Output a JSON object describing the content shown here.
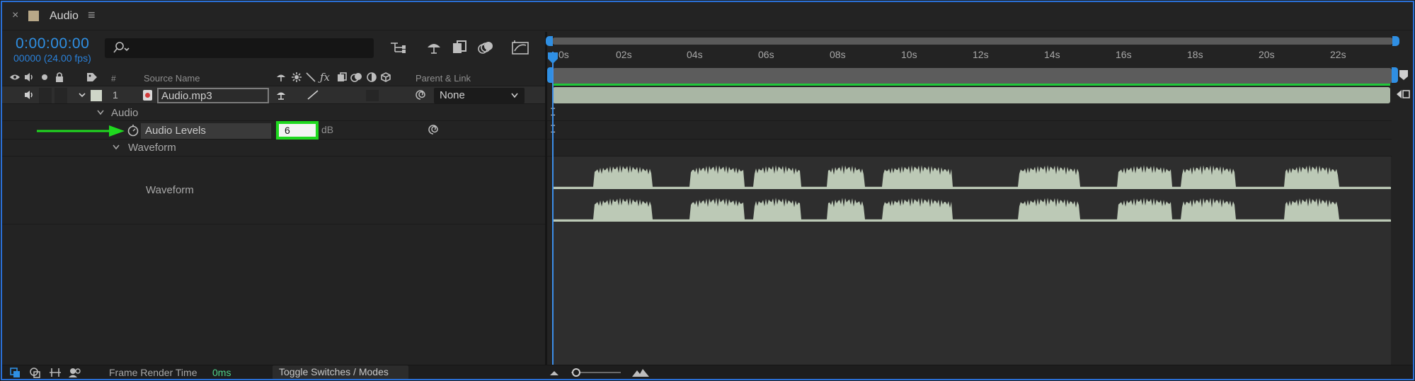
{
  "titlebar": {
    "close_glyph": "×",
    "comp_name": "Audio",
    "menu_glyph": "≡"
  },
  "time": {
    "timecode": "0:00:00:00",
    "frames": "00000 (24.00 fps)"
  },
  "search": {
    "placeholder": ""
  },
  "columns": {
    "hash": "#",
    "source_name": "Source Name",
    "parent_link": "Parent & Link"
  },
  "layer": {
    "number": "1",
    "name": "Audio.mp3",
    "parent": "None"
  },
  "properties": {
    "audio_group": "Audio",
    "audio_levels_label": "Audio Levels",
    "audio_levels_value": "6",
    "audio_levels_unit": "dB",
    "waveform_group": "Waveform",
    "waveform_label": "Waveform"
  },
  "ruler": {
    "ticks": [
      "0s",
      "02s",
      "04s",
      "06s",
      "08s",
      "10s",
      "12s",
      "14s",
      "16s",
      "18s",
      "20s",
      "22s"
    ]
  },
  "status": {
    "frame_render_label": "Frame Render Time",
    "frame_render_value": "0ms",
    "toggle_label": "Toggle Switches / Modes"
  },
  "colors": {
    "accent": "#2f8fe3",
    "highlight": "#1fd81f",
    "layer_bar": "#a9b6a4",
    "waveform": "#bcc9b6",
    "label_swatch": "#cfd6c8"
  },
  "icons": [
    "close-icon",
    "panel-menu-icon",
    "search-icon",
    "composition-flowchart-icon",
    "shy-layers-icon",
    "frame-blending-icon",
    "motion-blur-icon",
    "graph-editor-icon",
    "eye-icon",
    "speaker-icon",
    "solo-icon",
    "lock-icon",
    "label-icon",
    "stopwatch-icon",
    "pickwhip-icon",
    "playhead-icon"
  ]
}
